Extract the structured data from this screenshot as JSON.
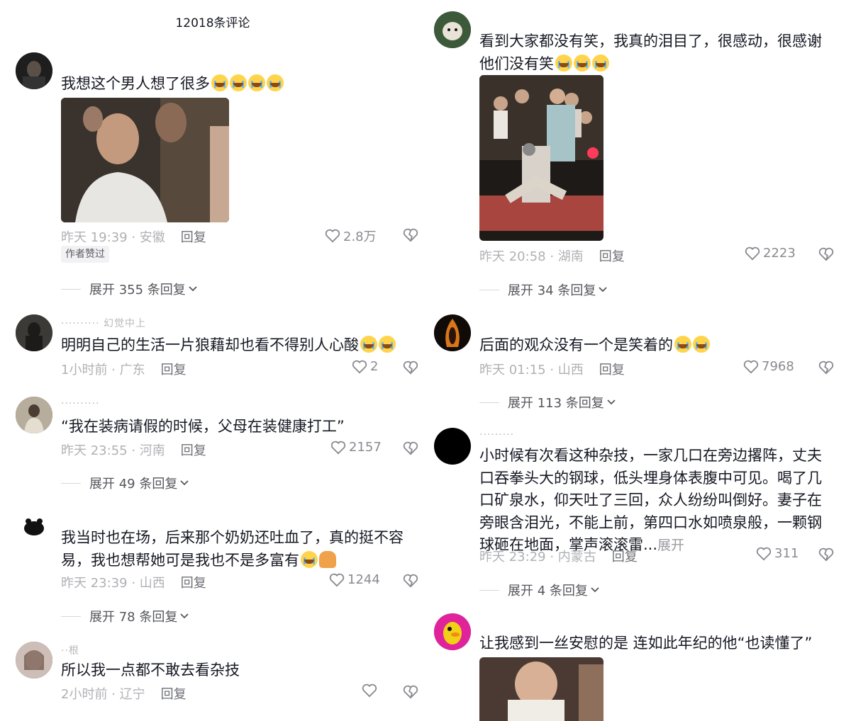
{
  "header": {
    "title": "12018条评论"
  },
  "left": [
    {
      "id": "c1",
      "avatar_icon": "dark-portrait-avatar",
      "username": "",
      "text": "我想这个男人想了很多",
      "emoji": [
        "crying",
        "crying",
        "crying",
        "crying"
      ],
      "has_image": true,
      "time": "昨天 19:39 · 安徽",
      "reply": "回复",
      "likes": "2.8万",
      "badge": "作者赞过",
      "expand": "展开 355 条回复"
    },
    {
      "id": "c2",
      "avatar_icon": "dark-silhouette-avatar",
      "username": "·········· 幻觉中上",
      "text": "明明自己的生活一片狼藉却也看不得别人心酸",
      "emoji": [
        "sad",
        "sad"
      ],
      "time": "1小时前 · 广东",
      "reply": "回复",
      "likes": "2"
    },
    {
      "id": "c3",
      "avatar_icon": "person-avatar",
      "username": "··········",
      "text": "“我在装病请假的时候，父母在装健康打工”",
      "emoji": [],
      "time": "昨天 23:55 · 河南",
      "reply": "回复",
      "likes": "2157",
      "expand": "展开 49 条回复"
    },
    {
      "id": "c4",
      "avatar_icon": "cartoon-avatar",
      "username": "",
      "text": "我当时也在场，后来那个奶奶还吐血了，真的挺不容易，我也想帮她可是我也不是多富有",
      "emoji": [
        "crying",
        "pray"
      ],
      "time": "昨天 23:39 · 山西",
      "reply": "回复",
      "likes": "1244",
      "expand": "展开 78 条回复"
    },
    {
      "id": "c5",
      "avatar_icon": "girl-avatar",
      "username": "··根",
      "text": "所以我一点都不敢去看杂技",
      "emoji": [],
      "time": "2小时前 · 辽宁",
      "reply": "回复",
      "likes": ""
    }
  ],
  "right": [
    {
      "id": "r1",
      "avatar_icon": "dog-avatar",
      "username": "",
      "text": "看到大家都没有笑，我真的泪目了，很感动，很感谢他们没有笑",
      "emoji": [
        "crying",
        "crying",
        "crying"
      ],
      "has_image": true,
      "time": "昨天 20:58 · 湖南",
      "reply": "回复",
      "likes": "2223",
      "expand": "展开 34 条回复"
    },
    {
      "id": "r2",
      "avatar_icon": "fire-figure-avatar",
      "username": "",
      "text": "后面的观众没有一个是笑着的",
      "emoji": [
        "crying",
        "crying"
      ],
      "time": "昨天 01:15 · 山西",
      "reply": "回复",
      "likes": "7968",
      "expand": "展开 113 条回复"
    },
    {
      "id": "r3",
      "avatar_icon": "black-circle-avatar",
      "username": "·········",
      "text": "小时候有次看这种杂技，一家几口在旁边撂阵，丈夫口吞拳头大的钢球，低头埋身体表腹中可见。喝了几口矿泉水，仰天吐了三回，众人纷纷叫倒好。妻子在旁眼含泪光，不能上前，第四口水如喷泉般，一颗钢球砸在地面，掌声滚滚雷...",
      "more": "展开",
      "emoji": [],
      "time": "昨天 23:29 · 内蒙古",
      "reply": "回复",
      "likes": "311",
      "expand": "展开 4 条回复"
    },
    {
      "id": "r4",
      "avatar_icon": "duck-avatar",
      "username": "",
      "text": "让我感到一丝安慰的是 连如此年纪的他“也读懂了”",
      "emoji": [],
      "has_image": true
    }
  ],
  "colors": {
    "text": "#161823",
    "meta": "#b0b1b5",
    "reply": "#6e6f75"
  }
}
